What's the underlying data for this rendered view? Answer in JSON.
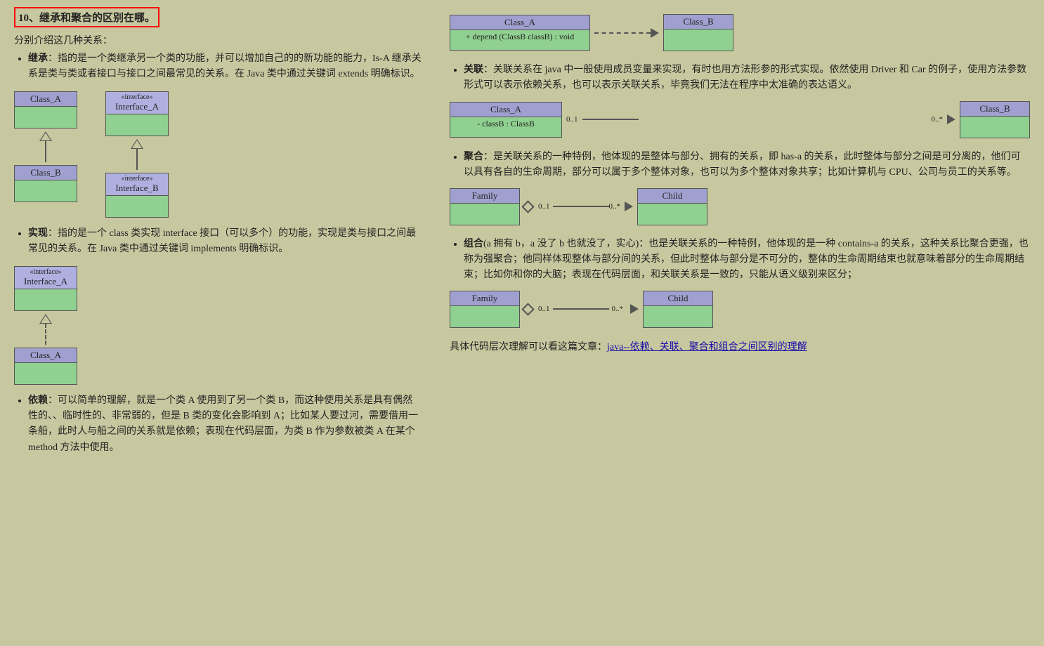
{
  "left": {
    "section_title": "10、继承和聚合的区别在哪。",
    "intro": "分别介绍这几种关系：",
    "items": [
      {
        "label": "继承",
        "text": "指的是一个类继承另一个类的功能，并可以增加自己的的新功能的能力，Is-A 继承关系是类与类或者接口与接口之间最常见的关系。在 Java 类中通过关键词 extends 明确标识。"
      },
      {
        "label": "实现",
        "text": "指的是一个 class 类实现 interface 接口（可以多个）的功能，实现是类与接口之间最常见的关系。在 Java 类中通过关键词 implements 明确标识。"
      },
      {
        "label": "依赖",
        "text": "可以简单的理解，就是一个类 A 使用到了另一个类 B，而这种使用关系是具有偶然性的、、临时性的、非常弱的，但是 B 类的变化会影响到 A；比如某人要过河，需要借用一条船，此时人与船之间的关系就是依赖；表现在代码层面，为类 B 作为参数被类 A 在某个 method 方法中使用。"
      }
    ],
    "diagrams": {
      "inherit": {
        "classA": "Class_A",
        "classB": "Class_B",
        "interfaceA": "Interface_A",
        "interfaceB": "Interface_B"
      },
      "impl": {
        "interfaceA": "Interface_A",
        "classA": "Class_A"
      },
      "dep": {
        "classA": "Class_A",
        "methodLabel": "+ depend (ClassB classB) : void",
        "classB": "Class_B"
      }
    }
  },
  "right": {
    "items": [
      {
        "label": "关联",
        "text": "关联关系在 java 中一般使用成员变量来实现，有时也用方法形参的形式实现。依然使用 Driver 和 Car 的例子，使用方法参数形式可以表示依赖关系，也可以表示关联关系，毕竟我们无法在程序中太准确的表达语义。"
      },
      {
        "label": "聚合",
        "text": "是关联关系的一种特例，他体现的是整体与部分、拥有的关系，即 has-a 的关系，此时整体与部分之间是可分离的，他们可以具有各自的生命周期，部分可以属于多个整体对象，也可以为多个整体对象共享；比如计算机与 CPU、公司与员工的关系等。"
      },
      {
        "label": "组合",
        "text": "组合(a 拥有 b，a 没了 b 也就没了，实心)：也是关联关系的一种特例，他体现的是一种 contains-a 的关系，这种关系比聚合更强，也称为强聚合；他同样体现整体与部分间的关系，但此时整体与部分是不可分的，整体的生命周期结束也就意味着部分的生命周期结束；比如你和你的大脑；表现在代码层面，和关联关系是一致的，只能从语义级别来区分；"
      }
    ],
    "diagrams": {
      "assoc": {
        "classA": "Class_A",
        "fieldLabel": "- classB : ClassB",
        "classB": "Class_B",
        "mult1": "0..1",
        "mult2": "0..*"
      },
      "aggregation": {
        "classA": "Family",
        "classB": "Child",
        "mult1": "0..1",
        "mult2": "0..*"
      },
      "composition": {
        "classA": "Family",
        "classB": "Child",
        "mult1": "0..1",
        "mult2": "0..*"
      }
    },
    "footer_text": "具体代码层次理解可以看这篇文章：java--依赖、关联、聚合和组合之间区别的理解",
    "footer_link": "java--依赖、关联、聚合和组合之间区别的理解"
  }
}
